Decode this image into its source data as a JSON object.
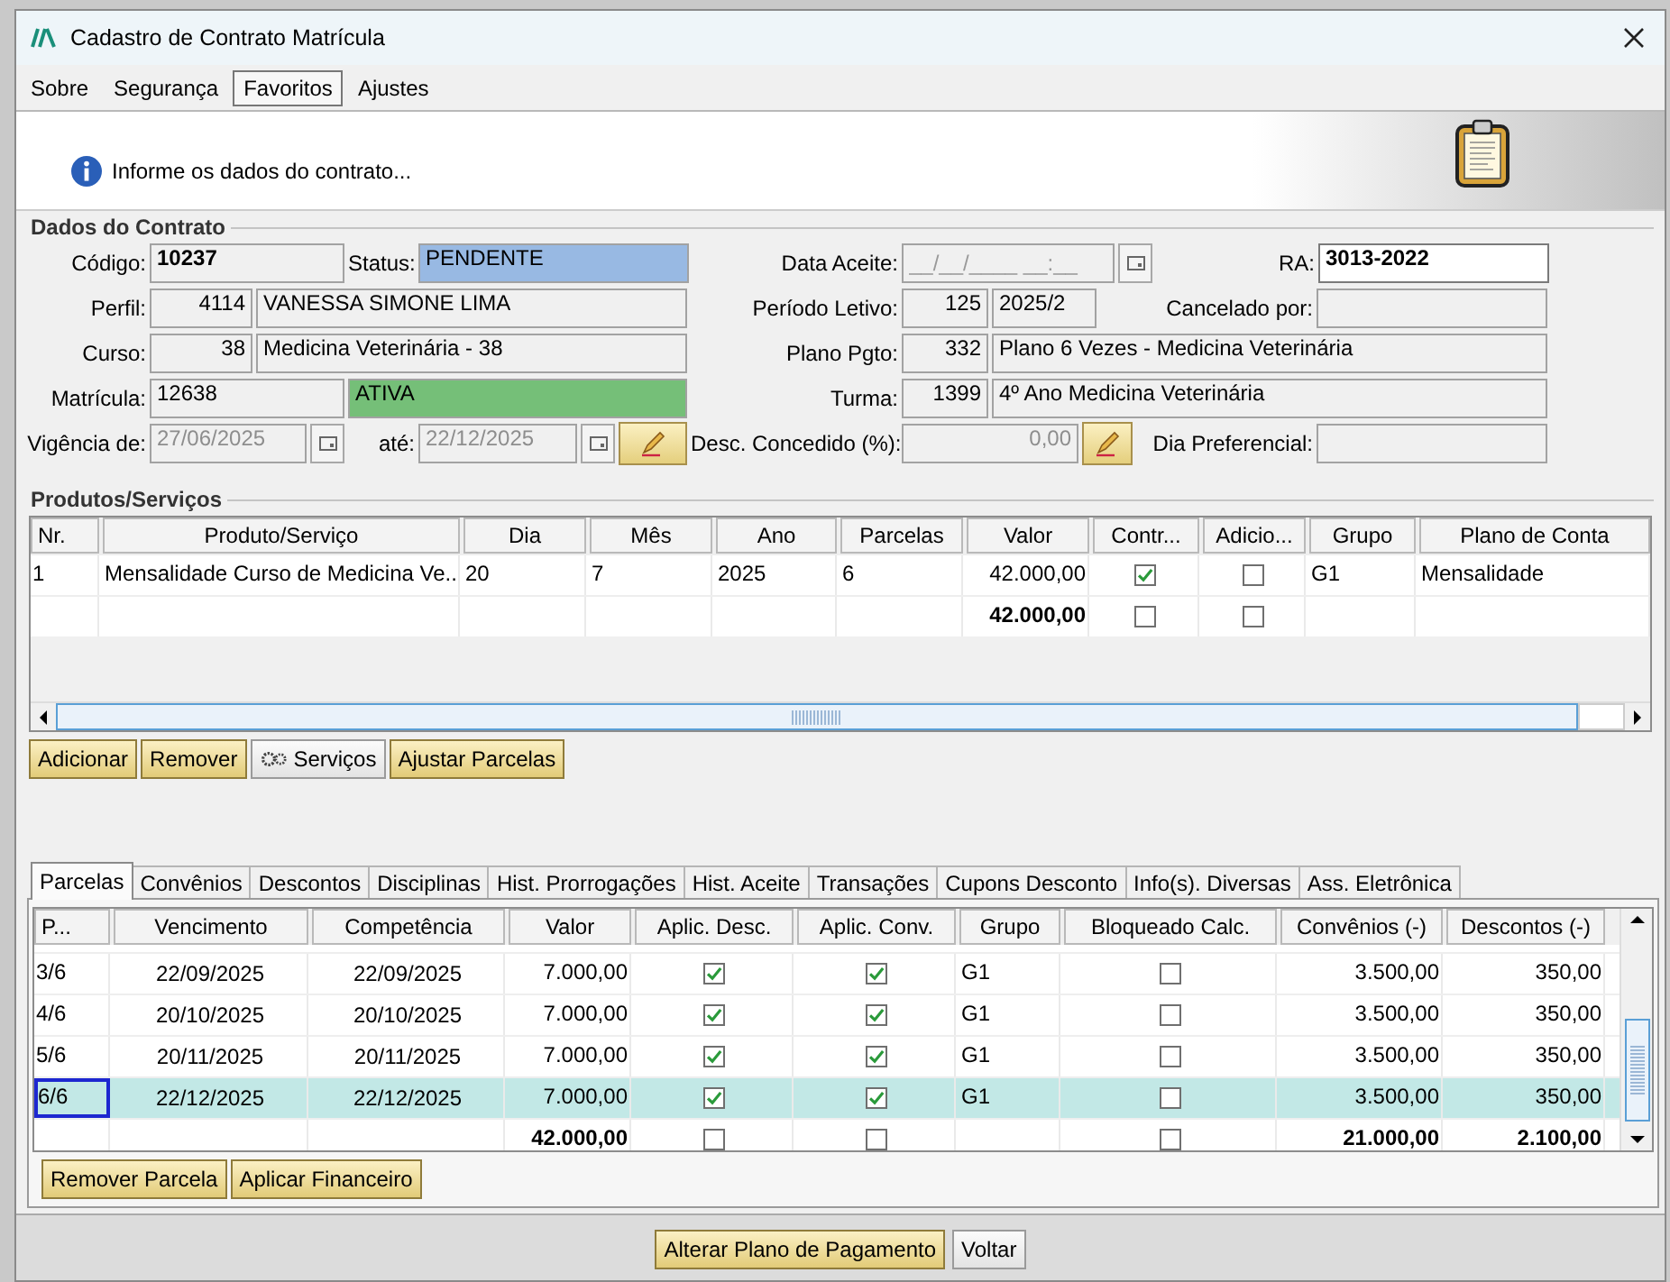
{
  "window": {
    "title": "Cadastro de Contrato Matrícula"
  },
  "menu": [
    {
      "label": "Sobre",
      "selected": false
    },
    {
      "label": "Segurança",
      "selected": false
    },
    {
      "label": "Favoritos",
      "selected": true
    },
    {
      "label": "Ajustes",
      "selected": false
    }
  ],
  "banner": {
    "message": "Informe os dados do contrato..."
  },
  "contract": {
    "title": "Dados do Contrato",
    "codigo": {
      "label": "Código:",
      "value": "10237"
    },
    "status": {
      "label": "Status:",
      "value": "PENDENTE",
      "color": "#98b9e3"
    },
    "data_aceite": {
      "label": "Data Aceite:",
      "placeholder": "__/__/____ __:__"
    },
    "ra": {
      "label": "RA:",
      "value": "3013-2022"
    },
    "perfil": {
      "label": "Perfil:",
      "code": "4114",
      "value": "VANESSA SIMONE LIMA"
    },
    "periodo": {
      "label": "Período Letivo:",
      "code": "125",
      "value": "2025/2"
    },
    "cancelado": {
      "label": "Cancelado por:"
    },
    "curso": {
      "label": "Curso:",
      "code": "38",
      "value": "Medicina Veterinária - 38"
    },
    "plano": {
      "label": "Plano Pgto:",
      "code": "332",
      "value": "Plano 6 Vezes - Medicina Veterinária"
    },
    "matricula": {
      "label": "Matrícula:",
      "value": "12638",
      "situacao": "ATIVA",
      "color": "#75bf78"
    },
    "turma": {
      "label": "Turma:",
      "code": "1399",
      "value": "4º Ano Medicina Veterinária"
    },
    "vigencia": {
      "label": "Vigência de:",
      "value": "27/06/2025",
      "disabled": true
    },
    "ate": {
      "label": "até:",
      "value": "22/12/2025",
      "disabled": true
    },
    "desconto": {
      "label": "Desc. Concedido (%):",
      "value": "0,00",
      "disabled": true
    },
    "dia": {
      "label": "Dia Preferencial:"
    }
  },
  "products": {
    "title": "Produtos/Serviços",
    "columns": [
      "Nr.",
      "Produto/Serviço",
      "Dia",
      "Mês",
      "Ano",
      "Parcelas",
      "Valor",
      "Contr...",
      "Adicio...",
      "Grupo",
      "Plano de Conta"
    ],
    "rows": [
      {
        "kind": "item",
        "nr": "1",
        "produto": "Mensalidade Curso de Medicina Ve...",
        "dia": "20",
        "mes": "7",
        "ano": "2025",
        "parcelas": "6",
        "valor": "42.000,00",
        "contr": true,
        "adic": false,
        "grupo": "G1",
        "plano": "Mensalidade"
      },
      {
        "kind": "total",
        "valor": "42.000,00",
        "contr": false,
        "adic": false
      }
    ],
    "buttons": [
      {
        "label": "Adicionar",
        "kind": "yellow"
      },
      {
        "label": "Remover",
        "kind": "yellow"
      },
      {
        "label": "Serviços",
        "kind": "gear"
      },
      {
        "label": "Ajustar Parcelas",
        "kind": "yellow"
      }
    ]
  },
  "tabs": [
    {
      "label": "Parcelas",
      "selected": true
    },
    {
      "label": "Convênios",
      "selected": false
    },
    {
      "label": "Descontos",
      "selected": false
    },
    {
      "label": "Disciplinas",
      "selected": false
    },
    {
      "label": "Hist. Prorrogações",
      "selected": false
    },
    {
      "label": "Hist. Aceite",
      "selected": false
    },
    {
      "label": "Transações",
      "selected": false
    },
    {
      "label": "Cupons Desconto",
      "selected": false
    },
    {
      "label": "Info(s). Diversas",
      "selected": false
    },
    {
      "label": "Ass. Eletrônica",
      "selected": false
    }
  ],
  "installments": {
    "columns": [
      "P...",
      "Vencimento",
      "Competência",
      "Valor",
      "Aplic. Desc.",
      "Aplic. Conv.",
      "Grupo",
      "Bloqueado Calc.",
      "Convênios (-)",
      "Descontos (-)"
    ],
    "rows": [
      {
        "kind": "item",
        "selected": false,
        "parcela": "3/6",
        "venc": "22/09/2025",
        "comp": "22/09/2025",
        "valor": "7.000,00",
        "desc": true,
        "conv": true,
        "grupo": "G1",
        "bloq": false,
        "convenios": "3.500,00",
        "descontos": "350,00"
      },
      {
        "kind": "item",
        "selected": false,
        "parcela": "4/6",
        "venc": "20/10/2025",
        "comp": "20/10/2025",
        "valor": "7.000,00",
        "desc": true,
        "conv": true,
        "grupo": "G1",
        "bloq": false,
        "convenios": "3.500,00",
        "descontos": "350,00"
      },
      {
        "kind": "item",
        "selected": false,
        "parcela": "5/6",
        "venc": "20/11/2025",
        "comp": "20/11/2025",
        "valor": "7.000,00",
        "desc": true,
        "conv": true,
        "grupo": "G1",
        "bloq": false,
        "convenios": "3.500,00",
        "descontos": "350,00"
      },
      {
        "kind": "item",
        "selected": true,
        "parcela": "6/6",
        "venc": "22/12/2025",
        "comp": "22/12/2025",
        "valor": "7.000,00",
        "desc": true,
        "conv": true,
        "grupo": "G1",
        "bloq": false,
        "convenios": "3.500,00",
        "descontos": "350,00"
      },
      {
        "kind": "total",
        "selected": false,
        "valor": "42.000,00",
        "desc": false,
        "conv": false,
        "bloq": false,
        "convenios": "21.000,00",
        "descontos": "2.100,00"
      }
    ],
    "buttons": [
      {
        "label": "Remover Parcela",
        "kind": "yellow"
      },
      {
        "label": "Aplicar Financeiro",
        "kind": "yellow"
      }
    ]
  },
  "footer": {
    "buttons": [
      {
        "label": "Alterar Plano de Pagamento",
        "kind": "yellow"
      },
      {
        "label": "Voltar",
        "kind": "plain"
      }
    ]
  }
}
